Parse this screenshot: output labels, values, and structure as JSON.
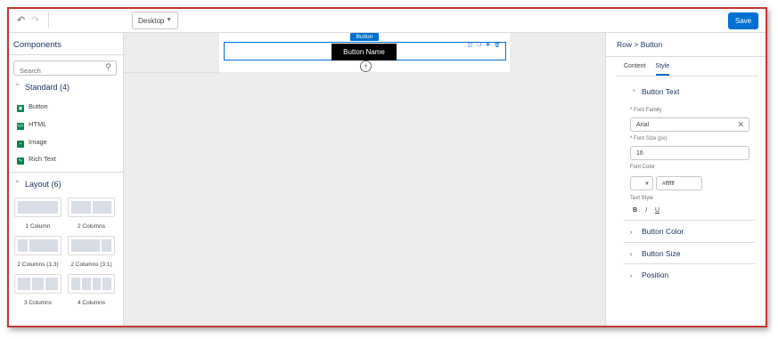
{
  "toolbar": {
    "undo_icon": "↶",
    "redo_icon": "↷",
    "device_value": "Desktop",
    "save_label": "Save",
    "accent_color": "#0070d2",
    "frame_color": "#c23934"
  },
  "components_panel": {
    "title": "Components",
    "search_placeholder": "Search",
    "standard": {
      "heading": "Standard (4)",
      "items": [
        {
          "label": "Button",
          "icon": "button-icon",
          "color": "#04844b"
        },
        {
          "label": "HTML",
          "icon": "html-icon",
          "color": "#04844b"
        },
        {
          "label": "Image",
          "icon": "image-icon",
          "color": "#04844b"
        },
        {
          "label": "Rich Text",
          "icon": "rich-text-icon",
          "color": "#04844b"
        }
      ]
    },
    "layout": {
      "heading": "Layout (6)",
      "tiles": [
        {
          "label": "1 Column"
        },
        {
          "label": "2 Columns"
        },
        {
          "label": "2 Columns (1:3)"
        },
        {
          "label": "2 Columns (3:1)"
        },
        {
          "label": "3 Columns"
        },
        {
          "label": "4 Columns"
        }
      ]
    }
  },
  "canvas": {
    "component_tag": "Button",
    "button_preview_text": "Button Name",
    "add_icon": "+"
  },
  "properties_panel": {
    "breadcrumb": "Row > Button",
    "tabs": [
      {
        "label": "Content",
        "active": false
      },
      {
        "label": "Style",
        "active": true
      }
    ],
    "button_text": {
      "heading": "Button Text",
      "font_family_label": "Font Family",
      "font_family_value": "Arial",
      "font_size_label": "Font Size (px)",
      "font_size_value": "16",
      "font_color_label": "Font Color",
      "font_color_value": "#ffffff",
      "text_style_label": "Text Style",
      "text_styles": [
        "B",
        "I",
        "U"
      ]
    },
    "sections": [
      {
        "heading": "Button Color"
      },
      {
        "heading": "Button Size"
      },
      {
        "heading": "Position"
      }
    ]
  }
}
